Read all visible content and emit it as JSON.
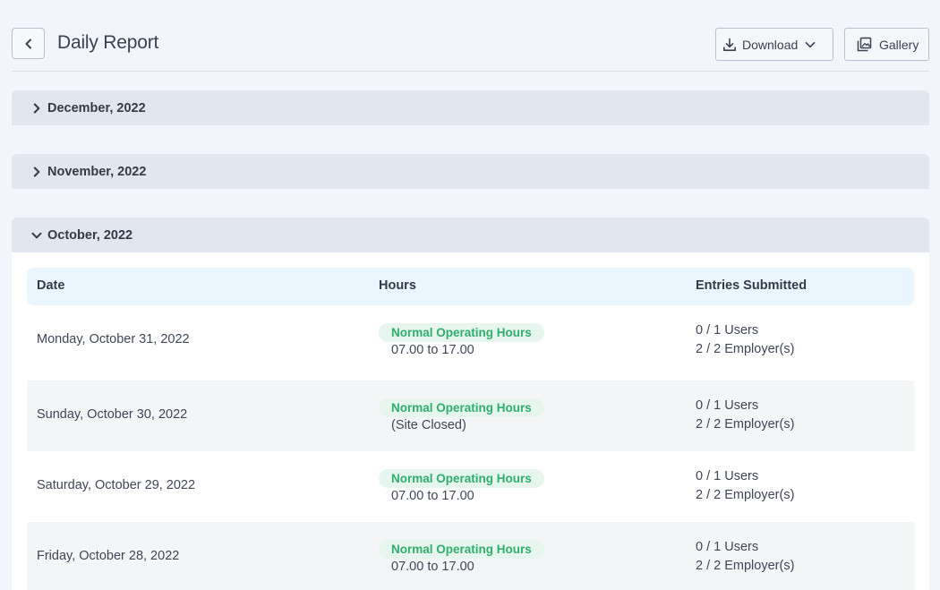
{
  "header": {
    "title": "Daily Report",
    "download_label": "Download",
    "gallery_label": "Gallery"
  },
  "months": [
    {
      "label": "December, 2022",
      "expanded": false
    },
    {
      "label": "November, 2022",
      "expanded": false
    },
    {
      "label": "October, 2022",
      "expanded": true
    }
  ],
  "table": {
    "columns": [
      "Date",
      "Hours",
      "Entries Submitted"
    ],
    "rows": [
      {
        "date": "Monday, October 31, 2022",
        "badge": "Normal Operating Hours",
        "hours": "07.00 to 17.00",
        "users": "0 / 1 Users",
        "employers": "2 / 2 Employer(s)"
      },
      {
        "date": "Sunday, October 30, 2022",
        "badge": "Normal Operating Hours",
        "hours": "(Site Closed)",
        "users": "0 / 1 Users",
        "employers": "2 / 2 Employer(s)"
      },
      {
        "date": "Saturday, October 29, 2022",
        "badge": "Normal Operating Hours",
        "hours": "07.00 to 17.00",
        "users": "0 / 1 Users",
        "employers": "2 / 2 Employer(s)"
      },
      {
        "date": "Friday, October 28, 2022",
        "badge": "Normal Operating Hours",
        "hours": "07.00 to 17.00",
        "users": "0 / 1 Users",
        "employers": "2 / 2 Employer(s)"
      }
    ]
  },
  "colors": {
    "background": "#f2f5fb",
    "month_header": "#e1e6ef",
    "table_header": "#eaf6fd",
    "badge_bg": "#e6f6ee",
    "badge_text": "#2fae6e"
  },
  "icons": {
    "back": "chevron-left-icon",
    "download": "download-icon",
    "dropdown": "chevron-down-icon",
    "gallery": "gallery-icon",
    "collapsed": "chevron-right-icon",
    "expanded": "chevron-down-icon"
  }
}
